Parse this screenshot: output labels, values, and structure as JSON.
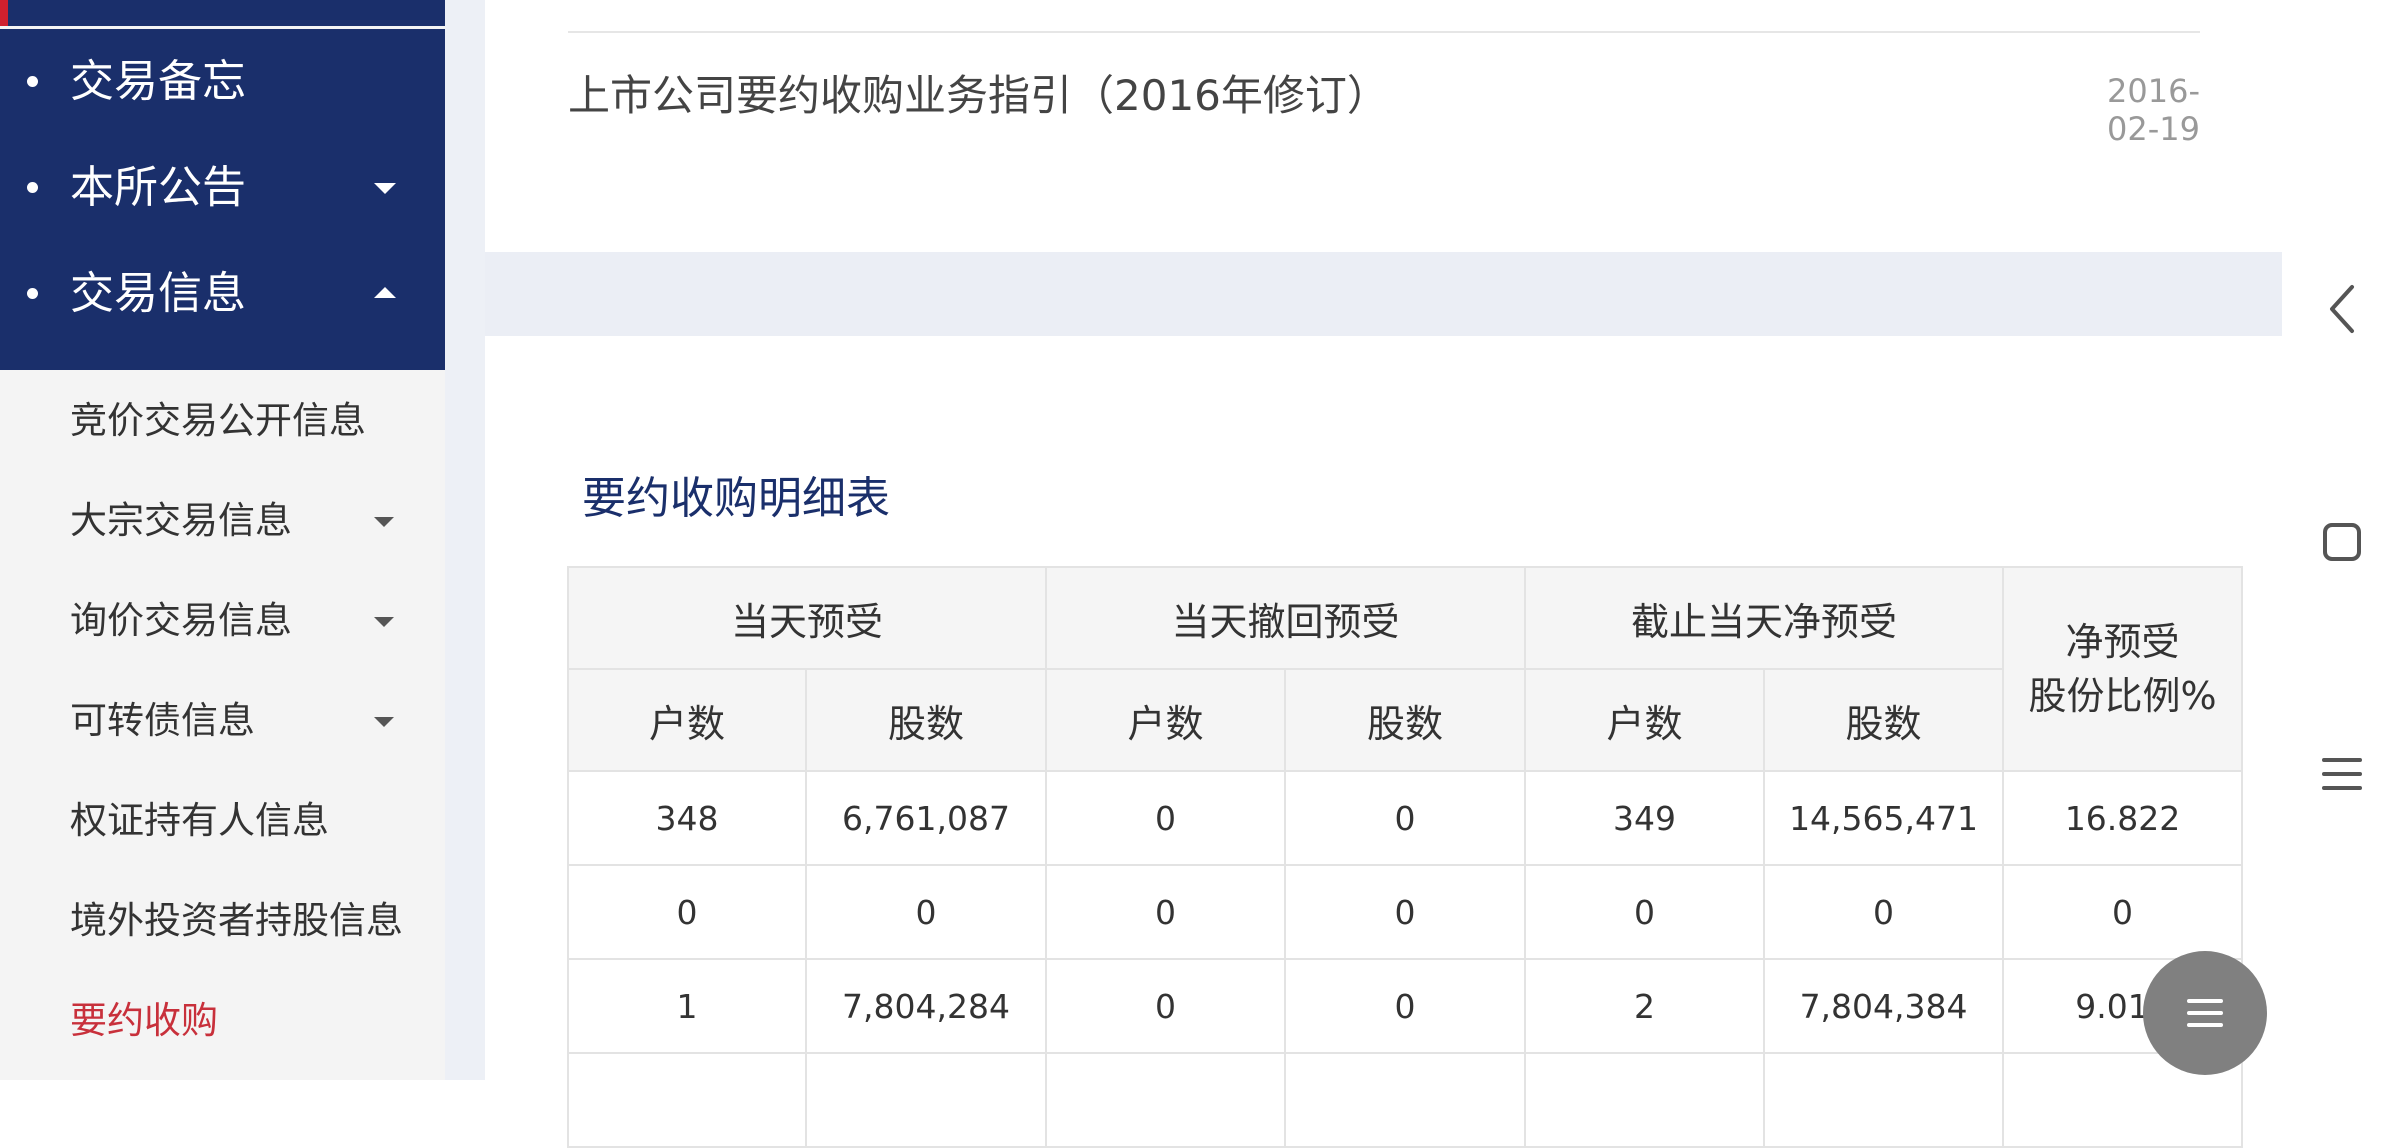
{
  "sidebar": {
    "primary": [
      {
        "label": "交易备忘",
        "has_caret": false
      },
      {
        "label": "本所公告",
        "has_caret": "down"
      },
      {
        "label": "交易信息",
        "has_caret": "up"
      }
    ],
    "sub_items": [
      {
        "label": "竞价交易公开信息"
      },
      {
        "label": "大宗交易信息"
      },
      {
        "label": "询价交易信息"
      },
      {
        "label": "可转债信息"
      },
      {
        "label": "权证持有人信息"
      },
      {
        "label": "境外投资者持股信息"
      },
      {
        "label": "要约收购",
        "active": true
      }
    ]
  },
  "document": {
    "title": "上市公司要约收购业务指引（2016年修订）",
    "date": "2016-02-19"
  },
  "section": {
    "title": "要约收购明细表"
  },
  "table": {
    "group_headers": [
      "当天预受",
      "当天撤回预受",
      "截止当天净预受"
    ],
    "ratio_header_line1": "净预受",
    "ratio_header_line2": "股份比例%",
    "sub_headers": [
      "户数",
      "股数",
      "户数",
      "股数",
      "户数",
      "股数"
    ],
    "rows": [
      [
        "348",
        "6,761,087",
        "0",
        "0",
        "349",
        "14,565,471",
        "16.822"
      ],
      [
        "0",
        "0",
        "0",
        "0",
        "0",
        "0",
        "0"
      ],
      [
        "1",
        "7,804,284",
        "0",
        "0",
        "2",
        "7,804,384",
        "9.013"
      ],
      [
        "",
        "",
        "",
        "",
        "",
        "",
        ""
      ]
    ]
  },
  "colors": {
    "nav_primary_bg": "#1a2f6b",
    "active_text": "#c8303b",
    "section_title": "#1a2f6b"
  },
  "icons": {
    "system_back": "back-chevron-icon",
    "system_home": "square-home-icon",
    "system_recents": "three-lines-icon",
    "fab": "menu-icon"
  }
}
